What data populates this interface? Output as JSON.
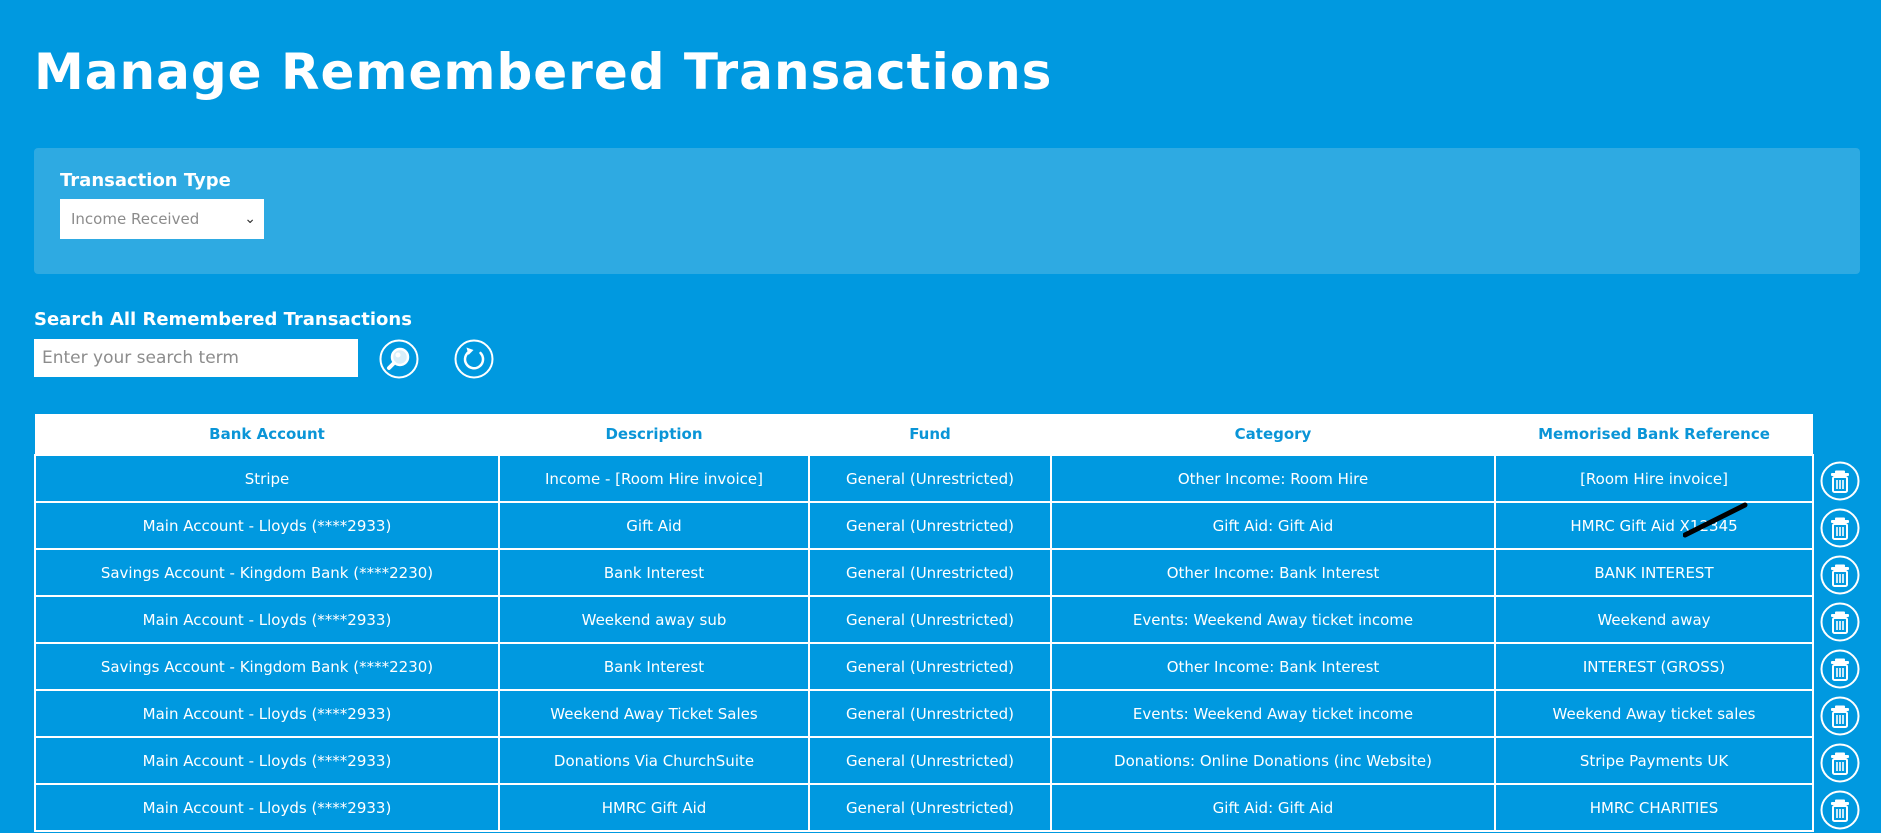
{
  "header": {
    "title": "Manage Remembered Transactions"
  },
  "filter": {
    "label": "Transaction Type",
    "selected": "Income Received"
  },
  "search": {
    "label": "Search All Remembered Transactions",
    "placeholder": "Enter your search term",
    "value": ""
  },
  "table": {
    "headers": [
      "Bank Account",
      "Description",
      "Fund",
      "Category",
      "Memorised Bank Reference"
    ],
    "rows": [
      [
        "Stripe",
        "Income - [Room Hire invoice]",
        "General (Unrestricted)",
        "Other Income: Room Hire",
        "[Room Hire invoice]"
      ],
      [
        "Main Account - Lloyds (****2933)",
        "Gift Aid",
        "General (Unrestricted)",
        "Gift Aid: Gift Aid",
        "HMRC Gift Aid X12345"
      ],
      [
        "Savings Account - Kingdom Bank (****2230)",
        "Bank Interest",
        "General (Unrestricted)",
        "Other Income: Bank Interest",
        "BANK INTEREST"
      ],
      [
        "Main Account - Lloyds (****2933)",
        "Weekend away sub",
        "General (Unrestricted)",
        "Events: Weekend Away ticket income",
        "Weekend away"
      ],
      [
        "Savings Account - Kingdom Bank (****2230)",
        "Bank Interest",
        "General (Unrestricted)",
        "Other Income: Bank Interest",
        "INTEREST (GROSS)"
      ],
      [
        "Main Account - Lloyds (****2933)",
        "Weekend Away Ticket Sales",
        "General (Unrestricted)",
        "Events: Weekend Away ticket income",
        "Weekend Away ticket sales"
      ],
      [
        "Main Account - Lloyds (****2933)",
        "Donations Via ChurchSuite",
        "General (Unrestricted)",
        "Donations: Online Donations (inc Website)",
        "Stripe Payments UK"
      ],
      [
        "Main Account - Lloyds (****2933)",
        "HMRC Gift Aid",
        "General (Unrestricted)",
        "Gift Aid: Gift Aid",
        "HMRC CHARITIES"
      ]
    ]
  },
  "icons": {
    "search": "magnifier-icon",
    "reset": "refresh-icon",
    "delete": "trash-icon"
  },
  "colors": {
    "background": "#0099e0",
    "panel": "#2eaae2",
    "header_text": "#0a95d7"
  }
}
